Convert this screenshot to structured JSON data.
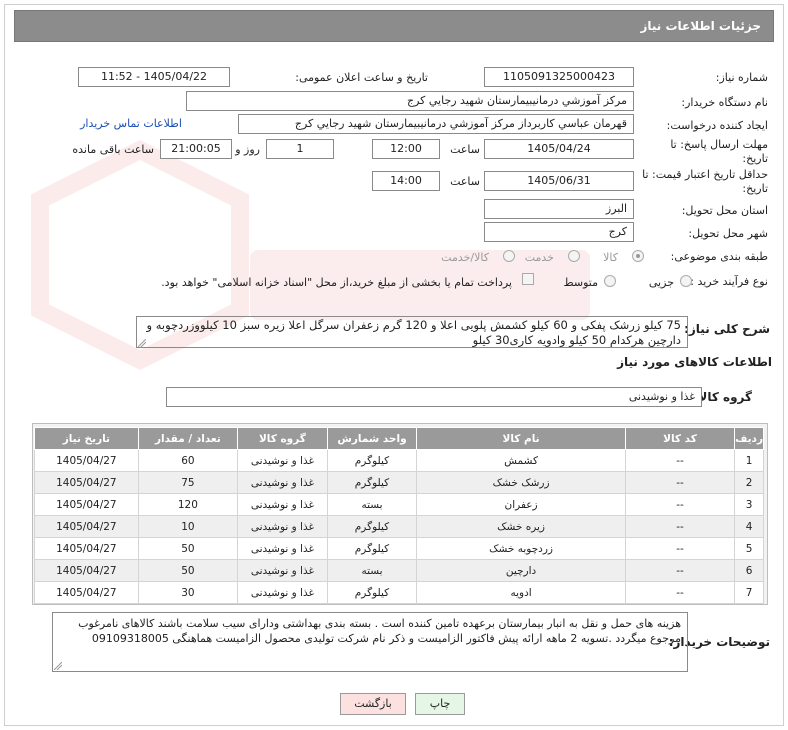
{
  "header": {
    "title": "جزئیات اطلاعات نیاز"
  },
  "fields": {
    "need_number_label": "شماره نیاز:",
    "need_number": "1105091325000423",
    "announce_label": "تاریخ و ساعت اعلان عمومی:",
    "announce_value": "1405/04/22 - 11:52",
    "buyer_label": "نام دستگاه خریدار:",
    "buyer_value": "مرکز آموزشي درمانيبيمارستان شهيد رجايي کرج",
    "creator_label": "ایجاد کننده درخواست:",
    "creator_value": "قهرمان عباسي کاربرداز مرکز آموزشي درمانيبيمارستان شهيد رجايي کرج",
    "contact_link": "اطلاعات تماس خریدار",
    "deadline_label": "مهلت ارسال پاسخ: تا تاریخ:",
    "deadline_date": "1405/04/24",
    "time_label": "ساعت",
    "deadline_time": "12:00",
    "days_value": "1",
    "days_label": "روز و",
    "remaining_time": "21:00:05",
    "remaining_label": "ساعت باقی مانده",
    "validity_label": "حداقل تاریخ اعتبار قیمت: تا تاریخ:",
    "validity_date": "1405/06/31",
    "validity_time_label": "ساعت",
    "validity_time": "14:00",
    "province_label": "استان محل تحویل:",
    "province_value": "البرز",
    "city_label": "شهر محل تحویل:",
    "city_value": "کرج",
    "category_label": "طبقه بندی موضوعی:",
    "category_options": [
      "کالا",
      "خدمت",
      "کالا/خدمت"
    ],
    "category_selected": "کالا",
    "process_label": "نوع فرآیند خرید :",
    "process_options": [
      "جزیی",
      "متوسط"
    ],
    "treasury_note": "پرداخت تمام یا بخشی از مبلغ خرید،از محل \"اسناد خزانه اسلامی\" خواهد بود."
  },
  "description": {
    "label": "شرح کلی نیاز:",
    "text": "75 کیلو زرشک پفکی و 60 کیلو کشمش پلویی اعلا و 120 گرم زعفران سرگل اعلا زیره سبز 10 کیلووزردچوبه و دارچین هرکدام 50 کیلو وادویه کاری30 کیلو"
  },
  "goods": {
    "section_title": "اطلاعات کالاهای مورد نیاز",
    "group_label": "گروه کالا:",
    "group_value": "غذا و نوشیدنی",
    "columns": [
      "ردیف",
      "کد کالا",
      "نام کالا",
      "واحد شمارش",
      "گروه کالا",
      "تعداد / مقدار",
      "تاریخ نیاز"
    ],
    "rows": [
      [
        "1",
        "--",
        "کشمش",
        "کیلوگرم",
        "غذا و نوشیدنی",
        "60",
        "1405/04/27"
      ],
      [
        "2",
        "--",
        "زرشک خشک",
        "کیلوگرم",
        "غذا و نوشیدنی",
        "75",
        "1405/04/27"
      ],
      [
        "3",
        "--",
        "زعفران",
        "بسته",
        "غذا و نوشیدنی",
        "120",
        "1405/04/27"
      ],
      [
        "4",
        "--",
        "زیره خشک",
        "کیلوگرم",
        "غذا و نوشیدنی",
        "10",
        "1405/04/27"
      ],
      [
        "5",
        "--",
        "زردچوبه خشک",
        "کیلوگرم",
        "غذا و نوشیدنی",
        "50",
        "1405/04/27"
      ],
      [
        "6",
        "--",
        "دارچین",
        "بسته",
        "غذا و نوشیدنی",
        "50",
        "1405/04/27"
      ],
      [
        "7",
        "--",
        "ادویه",
        "کیلوگرم",
        "غذا و نوشیدنی",
        "30",
        "1405/04/27"
      ]
    ]
  },
  "notes": {
    "label": "توضیحات خریدار:",
    "text": "هزینه های حمل و نقل به انبار بیمارستان برعهده تامین کننده است . بسته بندی بهداشتی ودارای سیب سلامت باشند کالاهای نامرغوب مرجوع میگردد .تسویه 2 ماهه ارائه پیش فاکتور الزامیست و ذکر نام شرکت تولیدی محصول الزامیست هماهنگی 09109318005"
  },
  "buttons": {
    "print": "چاپ",
    "back": "بازگشت"
  },
  "colors": {
    "header_bg": "#8c8c8c",
    "link": "#1a4fb4",
    "print_bg": "#e6f6e6",
    "back_bg": "#fde0e0"
  }
}
